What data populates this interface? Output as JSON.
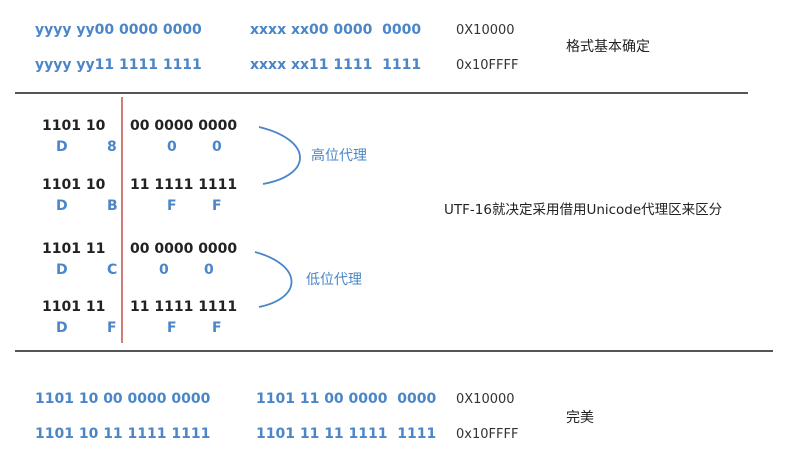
{
  "top": {
    "row1": {
      "col1": "yyyy yy00 0000 0000",
      "col2": "xxxx xx00 0000  0000",
      "hex": "0X10000"
    },
    "row2": {
      "col1": "yyyy yy11 1111 1111",
      "col2": "xxxx xx11 1111  1111",
      "hex": "0x10FFFF"
    },
    "label": "格式基本确定"
  },
  "middle": {
    "groups": [
      {
        "prefix": "1101 10",
        "bits": "00 0000 0000",
        "nib": [
          "D",
          "8",
          "0",
          "0"
        ]
      },
      {
        "prefix": "1101 10",
        "bits": "11 1111 1111",
        "nib": [
          "D",
          "B",
          "F",
          "F"
        ]
      },
      {
        "prefix": "1101 11",
        "bits": "00 0000 0000",
        "nib": [
          "D",
          "C",
          "0",
          "0"
        ]
      },
      {
        "prefix": "1101 11",
        "bits": "11 1111 1111",
        "nib": [
          "D",
          "F",
          "F",
          "F"
        ]
      }
    ],
    "high_label": "高位代理",
    "low_label": "低位代理",
    "note": "UTF-16就决定采用借用Unicode代理区来区分"
  },
  "bottom": {
    "row1": {
      "col1": "1101 10 00 0000 0000",
      "col2": "1101 11 00 0000  0000",
      "hex": "0X10000"
    },
    "row2": {
      "col1": "1101 10 11 1111 1111",
      "col2": "1101 11 11 1111  1111",
      "hex": "0x10FFFF"
    },
    "label": "完美"
  },
  "colors": {
    "accent": "#4a86c8",
    "divider": "#555555",
    "red_line": "#c0504d"
  }
}
